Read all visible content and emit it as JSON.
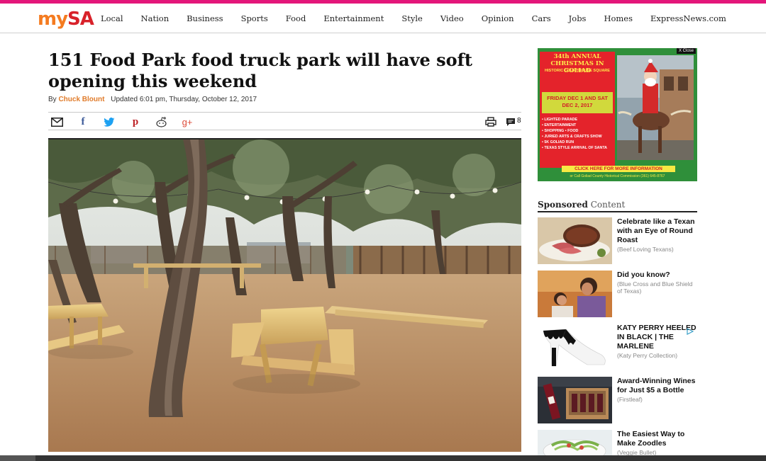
{
  "site": {
    "logo_my": "my",
    "logo_sa": "SA",
    "accent": "#e3167a"
  },
  "nav": [
    "Local",
    "Nation",
    "Business",
    "Sports",
    "Food",
    "Entertainment",
    "Style",
    "Video",
    "Opinion",
    "Cars",
    "Jobs",
    "Homes",
    "ExpressNews.com"
  ],
  "article": {
    "headline": "151 Food Park food truck park will have soft opening this weekend",
    "by": "By",
    "author": "Chuck Blount",
    "updated": "Updated 6:01 pm, Thursday, October 12, 2017",
    "comment_count": "8"
  },
  "share_icons": [
    "mail-icon",
    "facebook-icon",
    "twitter-icon",
    "pinterest-icon",
    "reddit-icon",
    "googleplus-icon",
    "print-icon",
    "comment-icon"
  ],
  "share_glyphs": {
    "facebook": "f",
    "pinterest": "p",
    "googleplus": "g+"
  },
  "ad": {
    "close": "X Close",
    "title": "34th ANNUAL CHRISTMAS IN GOLIAD",
    "subtitle": "HISTORIC COURTHOUSE SQUARE",
    "dates": "FRIDAY DEC 1 AND SAT DEC 2, 2017",
    "items": [
      "• LIGHTED PARADE",
      "• ENTERTAINMENT",
      "• SHOPPING • FOOD",
      "• JURIED ARTS & CRAFTS SHOW",
      "• 5K GOLIAD RUN",
      "• TEXAS STYLE ARRIVAL OF SANTA"
    ],
    "cta": "CLICK HERE FOR MORE INFORMATION",
    "footer": "or Call Goliad County Historical Commission (361) 645-8767"
  },
  "sponsored": {
    "label_bold": "Sponsored",
    "label_rest": " Content",
    "items": [
      {
        "title": "Celebrate like a Texan with an Eye of Round Roast",
        "source": "(Beef Loving Texans)"
      },
      {
        "title": "Did you know?",
        "source": "(Blue Cross and Blue Shield of Texas)"
      },
      {
        "title": "KATY PERRY HEELED IN BLACK | THE MARLENE",
        "source": "(Katy Perry Collection)"
      },
      {
        "title": "Award-Winning Wines for Just $5 a Bottle",
        "source": "(Firstleaf)"
      },
      {
        "title": "The Easiest Way to Make Zoodles",
        "source": "(Veggie Bullet)"
      }
    ]
  }
}
